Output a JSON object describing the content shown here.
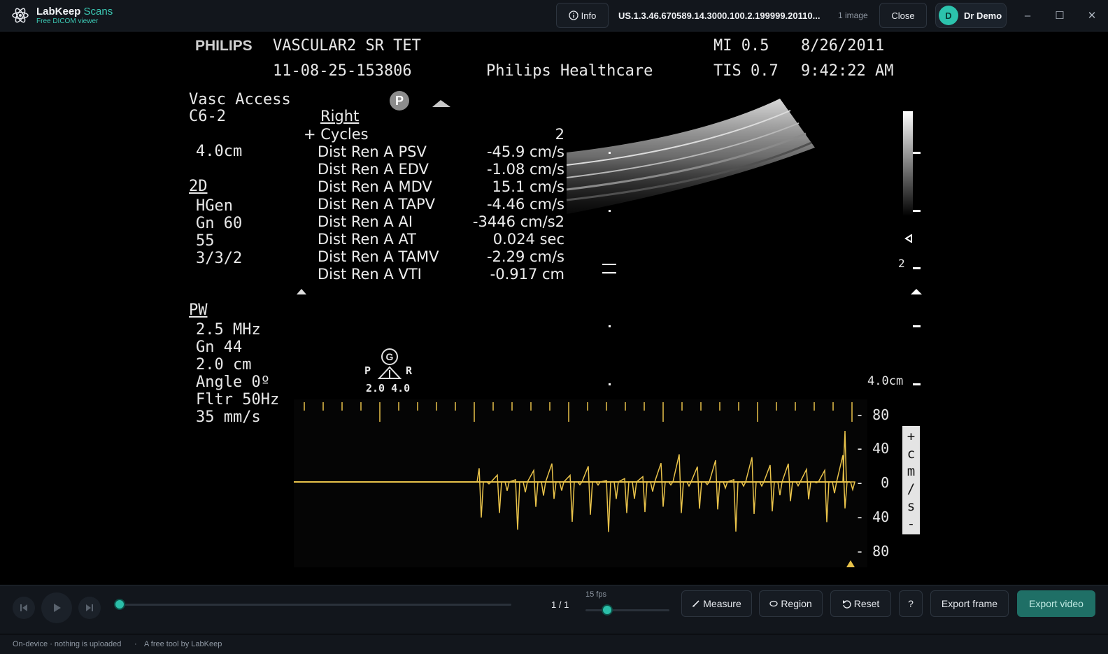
{
  "titlebar": {
    "app_name": "LabKeep",
    "app_name_accent": "Scans",
    "app_subtitle": "Free DICOM viewer",
    "info_label": "Info",
    "study_id": "US.1.3.46.670589.14.3000.100.2.199999.20110...",
    "image_count": "1 image",
    "close_label": "Close",
    "user_initial": "D",
    "user_name": "Dr Demo",
    "minimize": "–",
    "maximize": "☐",
    "close_window": "✕"
  },
  "ultrasound": {
    "vendor": "PHILIPS",
    "preset": "VASCULAR2 SR TET",
    "exam_id": "11-08-25-153806",
    "institution": "Philips Healthcare",
    "mi": "MI 0.5",
    "tis": "TIS 0.7",
    "date": "8/26/2011",
    "time": "9:42:22 AM",
    "left_panel": {
      "app": "Vasc Access",
      "probe": "C6-2",
      "depth": "4.0cm",
      "mode_2d": "2D",
      "mode_2d_params": [
        "HGen",
        "Gn 60",
        "55",
        "3/3/2"
      ],
      "mode_pw": "PW",
      "mode_pw_params": [
        "2.5 MHz",
        "Gn 44",
        "2.0 cm",
        "Angle 0º",
        "Fltr 50Hz",
        "35 mm/s"
      ]
    },
    "p_marker": "P",
    "g_marker": "G",
    "g_left": "P",
    "g_right": "R",
    "g_values": "2.0 4.0",
    "measurements": {
      "side": "Right",
      "cycles_label": "+ Cycles",
      "cycles_value": "2",
      "rows": [
        {
          "label": "Dist Ren A PSV",
          "value": "-45.9 cm/s"
        },
        {
          "label": "Dist Ren A EDV",
          "value": "-1.08 cm/s"
        },
        {
          "label": "Dist Ren A MDV",
          "value": "15.1 cm/s"
        },
        {
          "label": "Dist Ren A TAPV",
          "value": "-4.46 cm/s"
        },
        {
          "label": "Dist Ren A AI",
          "value": "-3446 cm/s2"
        },
        {
          "label": "Dist Ren A AT",
          "value": "0.024 sec"
        },
        {
          "label": "Dist Ren A TAMV",
          "value": "-2.29 cm/s"
        },
        {
          "label": "Dist Ren A VTI",
          "value": "-0.917 cm"
        }
      ]
    },
    "depth_scale_value": "2",
    "depth_scale_bottom": "4.0cm",
    "doppler_scale": [
      "80",
      "40",
      "0",
      "40",
      "80"
    ],
    "doppler_unit": [
      "+",
      "c",
      "m",
      "/",
      "s",
      "-"
    ]
  },
  "controls": {
    "frame_counter": "1 / 1",
    "fps_label": "15 fps",
    "fps_fraction": 0.26,
    "playback_fraction": 0,
    "measure_label": "Measure",
    "region_label": "Region",
    "reset_label": "Reset",
    "help_label": "?",
    "export_frame_label": "Export frame",
    "export_video_label": "Export video"
  },
  "footer": {
    "privacy": "On-device · nothing is uploaded",
    "separator": "·",
    "credit": "A free tool by LabKeep"
  },
  "colors": {
    "accent": "#2bbfa9",
    "doppler_trace": "#e8c24a"
  }
}
